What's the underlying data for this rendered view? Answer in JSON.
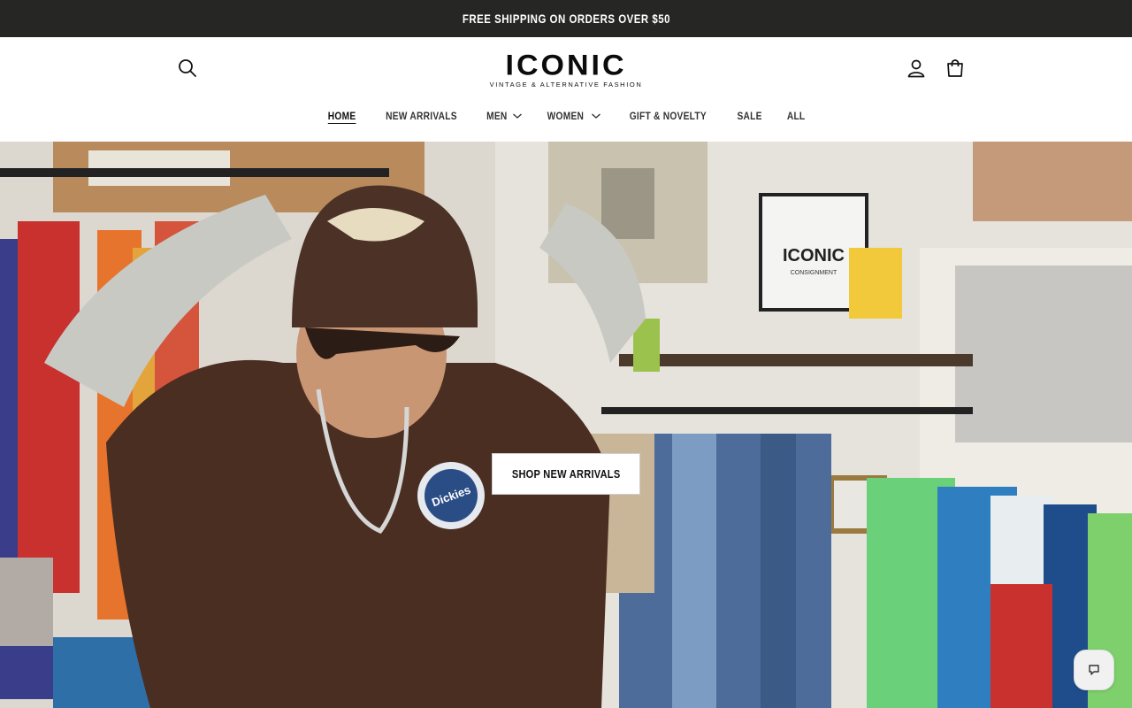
{
  "announcement": {
    "text": "FREE SHIPPING ON ORDERS OVER $50"
  },
  "logo": {
    "wordmark": "ICONIC",
    "tagline": "VINTAGE & ALTERNATIVE FASHION"
  },
  "header": {
    "icons": {
      "search": "search-icon",
      "account": "account-icon",
      "cart": "cart-icon"
    }
  },
  "nav": {
    "items": [
      {
        "label": "HOME",
        "active": true,
        "dropdown": false
      },
      {
        "label": "NEW ARRIVALS",
        "active": false,
        "dropdown": false
      },
      {
        "label": "MEN",
        "active": false,
        "dropdown": true
      },
      {
        "label": "WOMEN",
        "active": false,
        "dropdown": true
      },
      {
        "label": "GIFT & NOVELTY",
        "active": false,
        "dropdown": false
      },
      {
        "label": "SALE",
        "active": false,
        "dropdown": false
      },
      {
        "label": "ALL",
        "active": false,
        "dropdown": false
      }
    ]
  },
  "hero": {
    "cta_label": "SHOP NEW ARRIVALS",
    "sign_text": "ICONIC",
    "sign_subtext": "CONSIGNMENT",
    "shirt_logo_text": "Dickies"
  },
  "chat": {
    "icon": "chat-icon"
  },
  "colors": {
    "announcement_bg": "#262624",
    "text": "#121212",
    "background": "#ffffff"
  }
}
